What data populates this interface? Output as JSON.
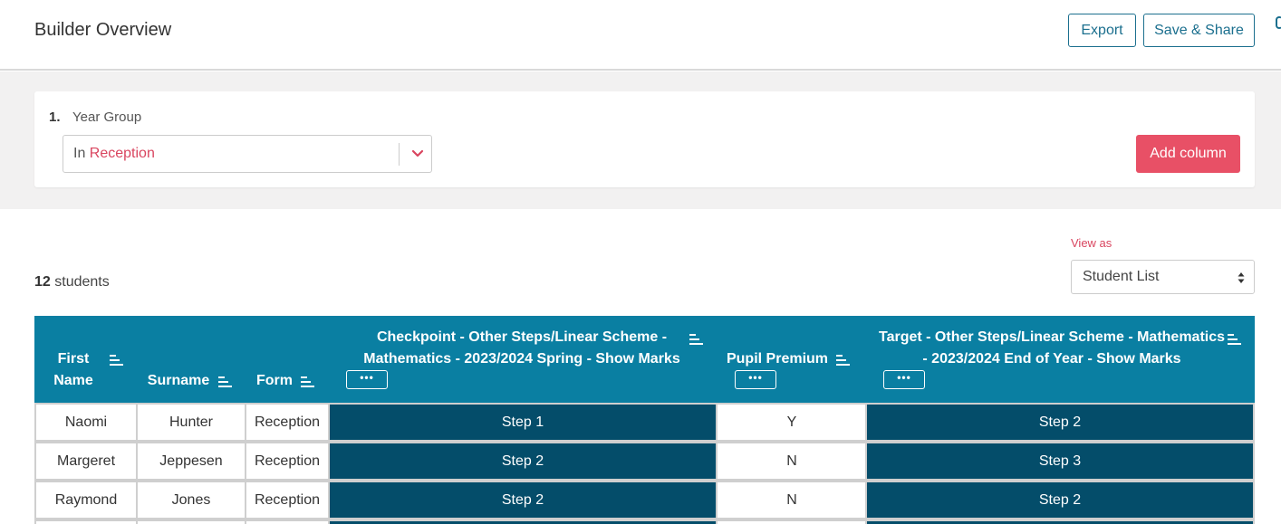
{
  "header": {
    "title": "Builder Overview",
    "export_label": "Export",
    "share_label": "Save & Share"
  },
  "filter": {
    "number": "1.",
    "label": "Year Group",
    "select_prefix": "In",
    "select_value": "Reception",
    "add_column_label": "Add column"
  },
  "view": {
    "label": "View as",
    "selected": "Student List"
  },
  "summary": {
    "count": "12",
    "count_suffix": "students"
  },
  "table": {
    "headers": {
      "first_name_line1": "First",
      "first_name_line2": "Name",
      "surname": "Surname",
      "form": "Form",
      "checkpoint_line1": "Checkpoint - Other Steps/Linear Scheme -",
      "checkpoint_line2": "Mathematics - 2023/2024 Spring - Show Marks",
      "pupil_premium": "Pupil Premium",
      "target_line1": "Target - Other Steps/Linear Scheme - Mathematics",
      "target_line2": "- 2023/2024 End of Year - Show Marks",
      "dots": "•••"
    },
    "rows": [
      {
        "first": "Naomi",
        "surname": "Hunter",
        "form": "Reception",
        "checkpoint": "Step 1",
        "pp": "Y",
        "target": "Step 2"
      },
      {
        "first": "Margeret",
        "surname": "Jeppesen",
        "form": "Reception",
        "checkpoint": "Step 2",
        "pp": "N",
        "target": "Step 3"
      },
      {
        "first": "Raymond",
        "surname": "Jones",
        "form": "Reception",
        "checkpoint": "Step 2",
        "pp": "N",
        "target": "Step 2"
      }
    ]
  },
  "colors": {
    "header_teal": "#0a7fa2",
    "cell_dark": "#044d6a",
    "accent_red": "#e85066",
    "outline_blue": "#1b6f8e"
  }
}
